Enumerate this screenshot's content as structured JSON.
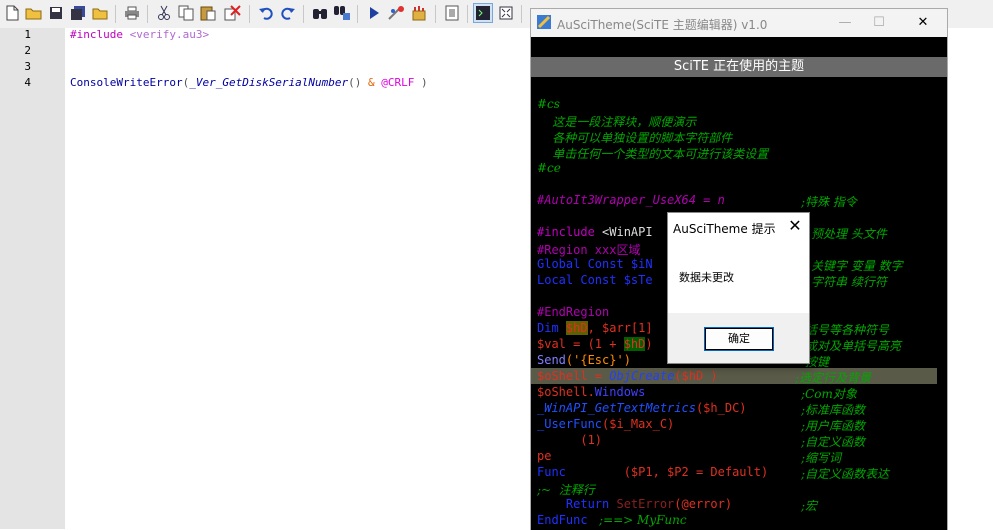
{
  "toolbar": {
    "icons": [
      "new-file-icon",
      "open-folder-icon",
      "save-icon",
      "save-all-icon",
      "close-icon",
      "print-icon",
      "cut-icon",
      "copy-icon",
      "paste-icon",
      "delete-icon",
      "undo-icon",
      "redo-icon",
      "find-icon",
      "replace-icon",
      "run-icon",
      "compile-icon",
      "tools-icon",
      "abbreviation-icon",
      "output-icon",
      "fullscreen-icon",
      "help-icon"
    ]
  },
  "editor": {
    "line_numbers": [
      "1",
      "2",
      "3",
      "4"
    ],
    "line1": {
      "directive": "#include",
      "space": " ",
      "arg": "<verify.au3>"
    },
    "line4": {
      "func": "ConsoleWriteError",
      "p1": "(",
      "udf": "_Ver_GetDiskSerialNumber",
      "p2": "()",
      "amp": " & ",
      "macro": "@CRLF",
      "p3": " )"
    }
  },
  "theme_window": {
    "title": "AuSciTheme(SciTE 主题编辑器) v1.0",
    "header": "SciTE 正在使用的主题",
    "min": "—",
    "max": "☐",
    "close": "✕",
    "lines": {
      "cs": "#cs",
      "c1": "    这是一段注释块，顺便演示",
      "c2": "    各种可以单独设置的脚本字符部件",
      "c3": "    单击任何一个类型的文本可进行该类设置",
      "ce": "#ce",
      "wrapper": "#AutoIt3Wrapper_UseX64 = n",
      "wrapper_cm": ";特殊 指令",
      "include": "#include",
      "include_arg": " <WinAPI",
      "include_cm": "预处理 头文件",
      "region": "#Region xxx区域",
      "global": "Global Const $iN",
      "global_cm": "关键字 变量 数字",
      "local": "Local Const $sTe",
      "local_cm": "字符串 续行符",
      "endregion": "#EndRegion",
      "dim": "Dim",
      "dim_var1": "$hD",
      "dim_rest": ", $arr[1]",
      "dim_cm": "括号等各种符号",
      "val": "$val = (1 + ",
      "val_var": "$hD",
      "val_end": ")",
      "val_cm": "成对及单括号高亮",
      "send": "Send",
      "send_arg": "('{Esc}')",
      "send_cm": "按键",
      "oshell": "$oShell",
      "oshell_eq": " = ",
      "objcreate": "ObjCreate",
      "oshell_arg": "($hD )",
      "oshell_cm": ";选定行及背景",
      "oshell2": "$oShell.",
      "windows": "Windows",
      "oshell2_cm": ";Com对象",
      "winapi": "_WinAPI_GetTextMetrics",
      "winapi_arg": "($h_DC)",
      "winapi_cm": ";标准库函数",
      "userfunc": "_UserFunc",
      "userfunc_arg": "($i_Max_C)",
      "userfunc_cm": ";用户库函数",
      "one": "      (1)",
      "one_cm": ";自定义函数",
      "pe": "pe",
      "pe_cm": ";缩写词",
      "func": "Func",
      "func_args": "        ($P1, $P2 = Default)",
      "func_cm": ";自定义函数表达",
      "comment_line": ";~  注释行",
      "return": "    Return",
      "seterror": " SetError",
      "seterror_arg": "(@error)",
      "return_cm": ";宏",
      "endfunc": "EndFunc",
      "endfunc_cm": "   ;==> MyFunc"
    }
  },
  "dialog": {
    "title": "AuSciTheme 提示",
    "message": "数据未更改",
    "ok": "确定",
    "close": "✕"
  },
  "colors": {
    "keyword_blue": "#0000ff",
    "comment_green": "#00a800",
    "preproc_magenta": "#c000c0",
    "variable_red": "#e00000",
    "string_orange": "#ff8c00"
  }
}
